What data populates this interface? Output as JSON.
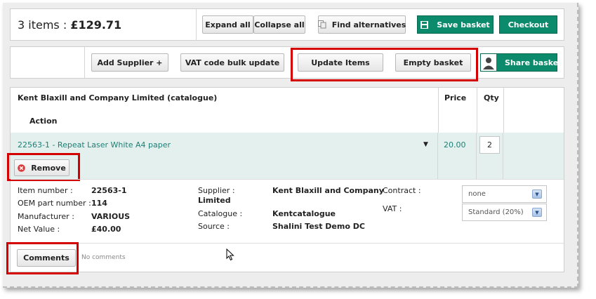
{
  "summary": {
    "items_label": "3 items : ",
    "total": "£129.71"
  },
  "toolbar": {
    "expand_all": "Expand all",
    "collapse_all": "Collapse all",
    "find_alternatives": "Find alternatives",
    "save_basket": "Save basket",
    "checkout": "Checkout"
  },
  "actions": {
    "add_supplier": "Add Supplier +",
    "vat_bulk": "VAT code bulk update",
    "update_items": "Update Items",
    "empty_basket": "Empty basket",
    "share_basket": "Share basket"
  },
  "table": {
    "supplier_header": "Kent Blaxill and Company Limited (catalogue)",
    "price_header": "Price",
    "qty_header": "Qty",
    "action_header": "Action"
  },
  "item": {
    "title": "22563-1 - Repeat Laser White A4 paper",
    "price": "20.00",
    "qty": "2",
    "remove_label": "Remove",
    "details": {
      "item_number_label": "Item number :",
      "item_number": "22563-1",
      "oem_label": "OEM part number :",
      "oem": "114",
      "manufacturer_label": "Manufacturer :",
      "manufacturer": "VARIOUS",
      "net_value_label": "Net Value :",
      "net_value": "£40.00",
      "supplier_label": "Supplier :",
      "supplier_line1": "Kent Blaxill and Company",
      "supplier_line2": "Limited",
      "catalogue_label": "Catalogue :",
      "catalogue": "Kentcatalogue",
      "source_label": "Source :",
      "source": "Shalini Test Demo DC",
      "contract_label": "Contract :",
      "contract_value": "none",
      "vat_label": "VAT :",
      "vat_value": "Standard (20%)"
    },
    "comments_label": "Comments",
    "comments_text": "No comments"
  },
  "colors": {
    "accent_green": "#0b8a6c",
    "link_teal": "#1d7f74",
    "highlight_red": "#d40000",
    "item_row_bg": "#e3f0ee"
  }
}
